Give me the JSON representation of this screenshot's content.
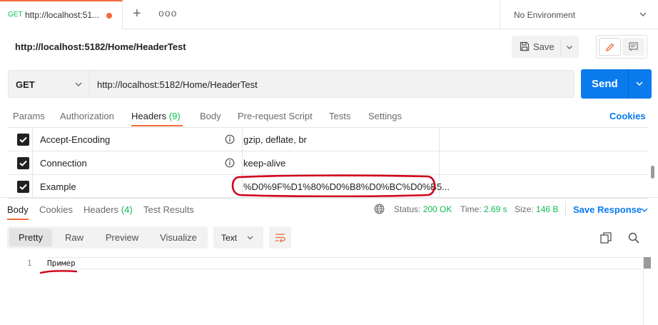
{
  "tab": {
    "method": "GET",
    "title": "http://localhost:51...",
    "more": "ooo"
  },
  "environment": {
    "label": "No Environment"
  },
  "request": {
    "title": "http://localhost:5182/Home/HeaderTest",
    "method": "GET",
    "url": "http://localhost:5182/Home/HeaderTest",
    "save_label": "Save",
    "send_label": "Send"
  },
  "request_tabs": {
    "params": "Params",
    "authorization": "Authorization",
    "headers": "Headers",
    "headers_count": "(9)",
    "body": "Body",
    "prerequest": "Pre-request Script",
    "tests": "Tests",
    "settings": "Settings",
    "cookies": "Cookies"
  },
  "headers": [
    {
      "key": "Accept-Encoding",
      "value": "gzip, deflate, br",
      "checked": true
    },
    {
      "key": "Connection",
      "value": "keep-alive",
      "checked": true
    },
    {
      "key": "Example",
      "value": "%D0%9F%D1%80%D0%B8%D0%BC%D0%B5...",
      "checked": true
    }
  ],
  "response": {
    "tabs": {
      "body": "Body",
      "cookies": "Cookies",
      "headers": "Headers",
      "headers_count": "(4)",
      "test_results": "Test Results"
    },
    "status_label": "Status:",
    "status_value": "200 OK",
    "time_label": "Time:",
    "time_value": "2.69 s",
    "size_label": "Size:",
    "size_value": "146 B",
    "save_response": "Save Response",
    "formats": {
      "pretty": "Pretty",
      "raw": "Raw",
      "preview": "Preview",
      "visualize": "Visualize"
    },
    "text_type": "Text",
    "line_number": "1",
    "body_text": "Пример"
  },
  "colors": {
    "accent": "#f26b3a",
    "send": "#097bed",
    "success": "#0cbb52",
    "annotation": "#d0021b"
  }
}
